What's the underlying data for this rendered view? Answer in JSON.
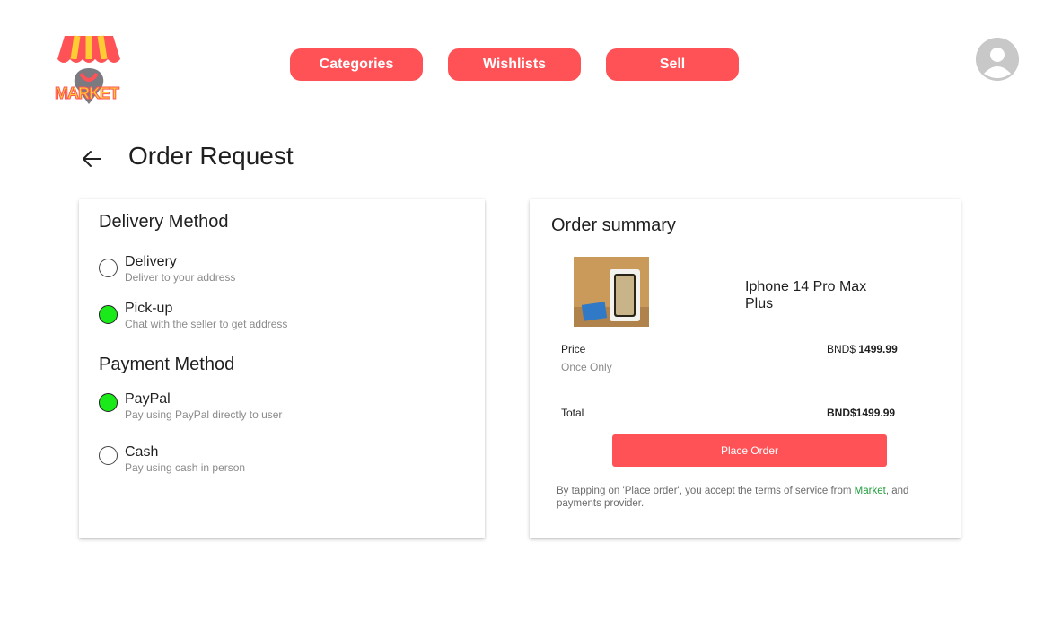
{
  "header": {
    "logo_text": "MARKET",
    "nav": [
      {
        "label": "Categories"
      },
      {
        "label": "Wishlists"
      },
      {
        "label": "Sell"
      }
    ]
  },
  "page": {
    "title": "Order Request"
  },
  "delivery": {
    "title": "Delivery Method",
    "options": [
      {
        "label": "Delivery",
        "description": "Deliver to your address",
        "selected": false
      },
      {
        "label": "Pick-up",
        "description": "Chat with the seller to get address",
        "selected": true
      }
    ]
  },
  "payment": {
    "title": "Payment Method",
    "options": [
      {
        "label": "PayPal",
        "description": "Pay using PayPal directly to user",
        "selected": true
      },
      {
        "label": "Cash",
        "description": "Pay using cash in person",
        "selected": false
      }
    ]
  },
  "summary": {
    "title": "Order summary",
    "product_name": "Iphone 14 Pro Max Plus",
    "price_label": "Price",
    "price_sub": "Once Only",
    "price_currency": "BND$",
    "price_amount": "1499.99",
    "total_label": "Total",
    "total_value": "BND$1499.99",
    "place_order_label": "Place Order",
    "terms_before": "By tapping on 'Place order', you accept the terms of service from ",
    "terms_link": "Market",
    "terms_after": ", and payments provider."
  },
  "colors": {
    "accent": "#ff5257",
    "selected_radio": "#1aea1a",
    "link": "#1e9e3a"
  }
}
